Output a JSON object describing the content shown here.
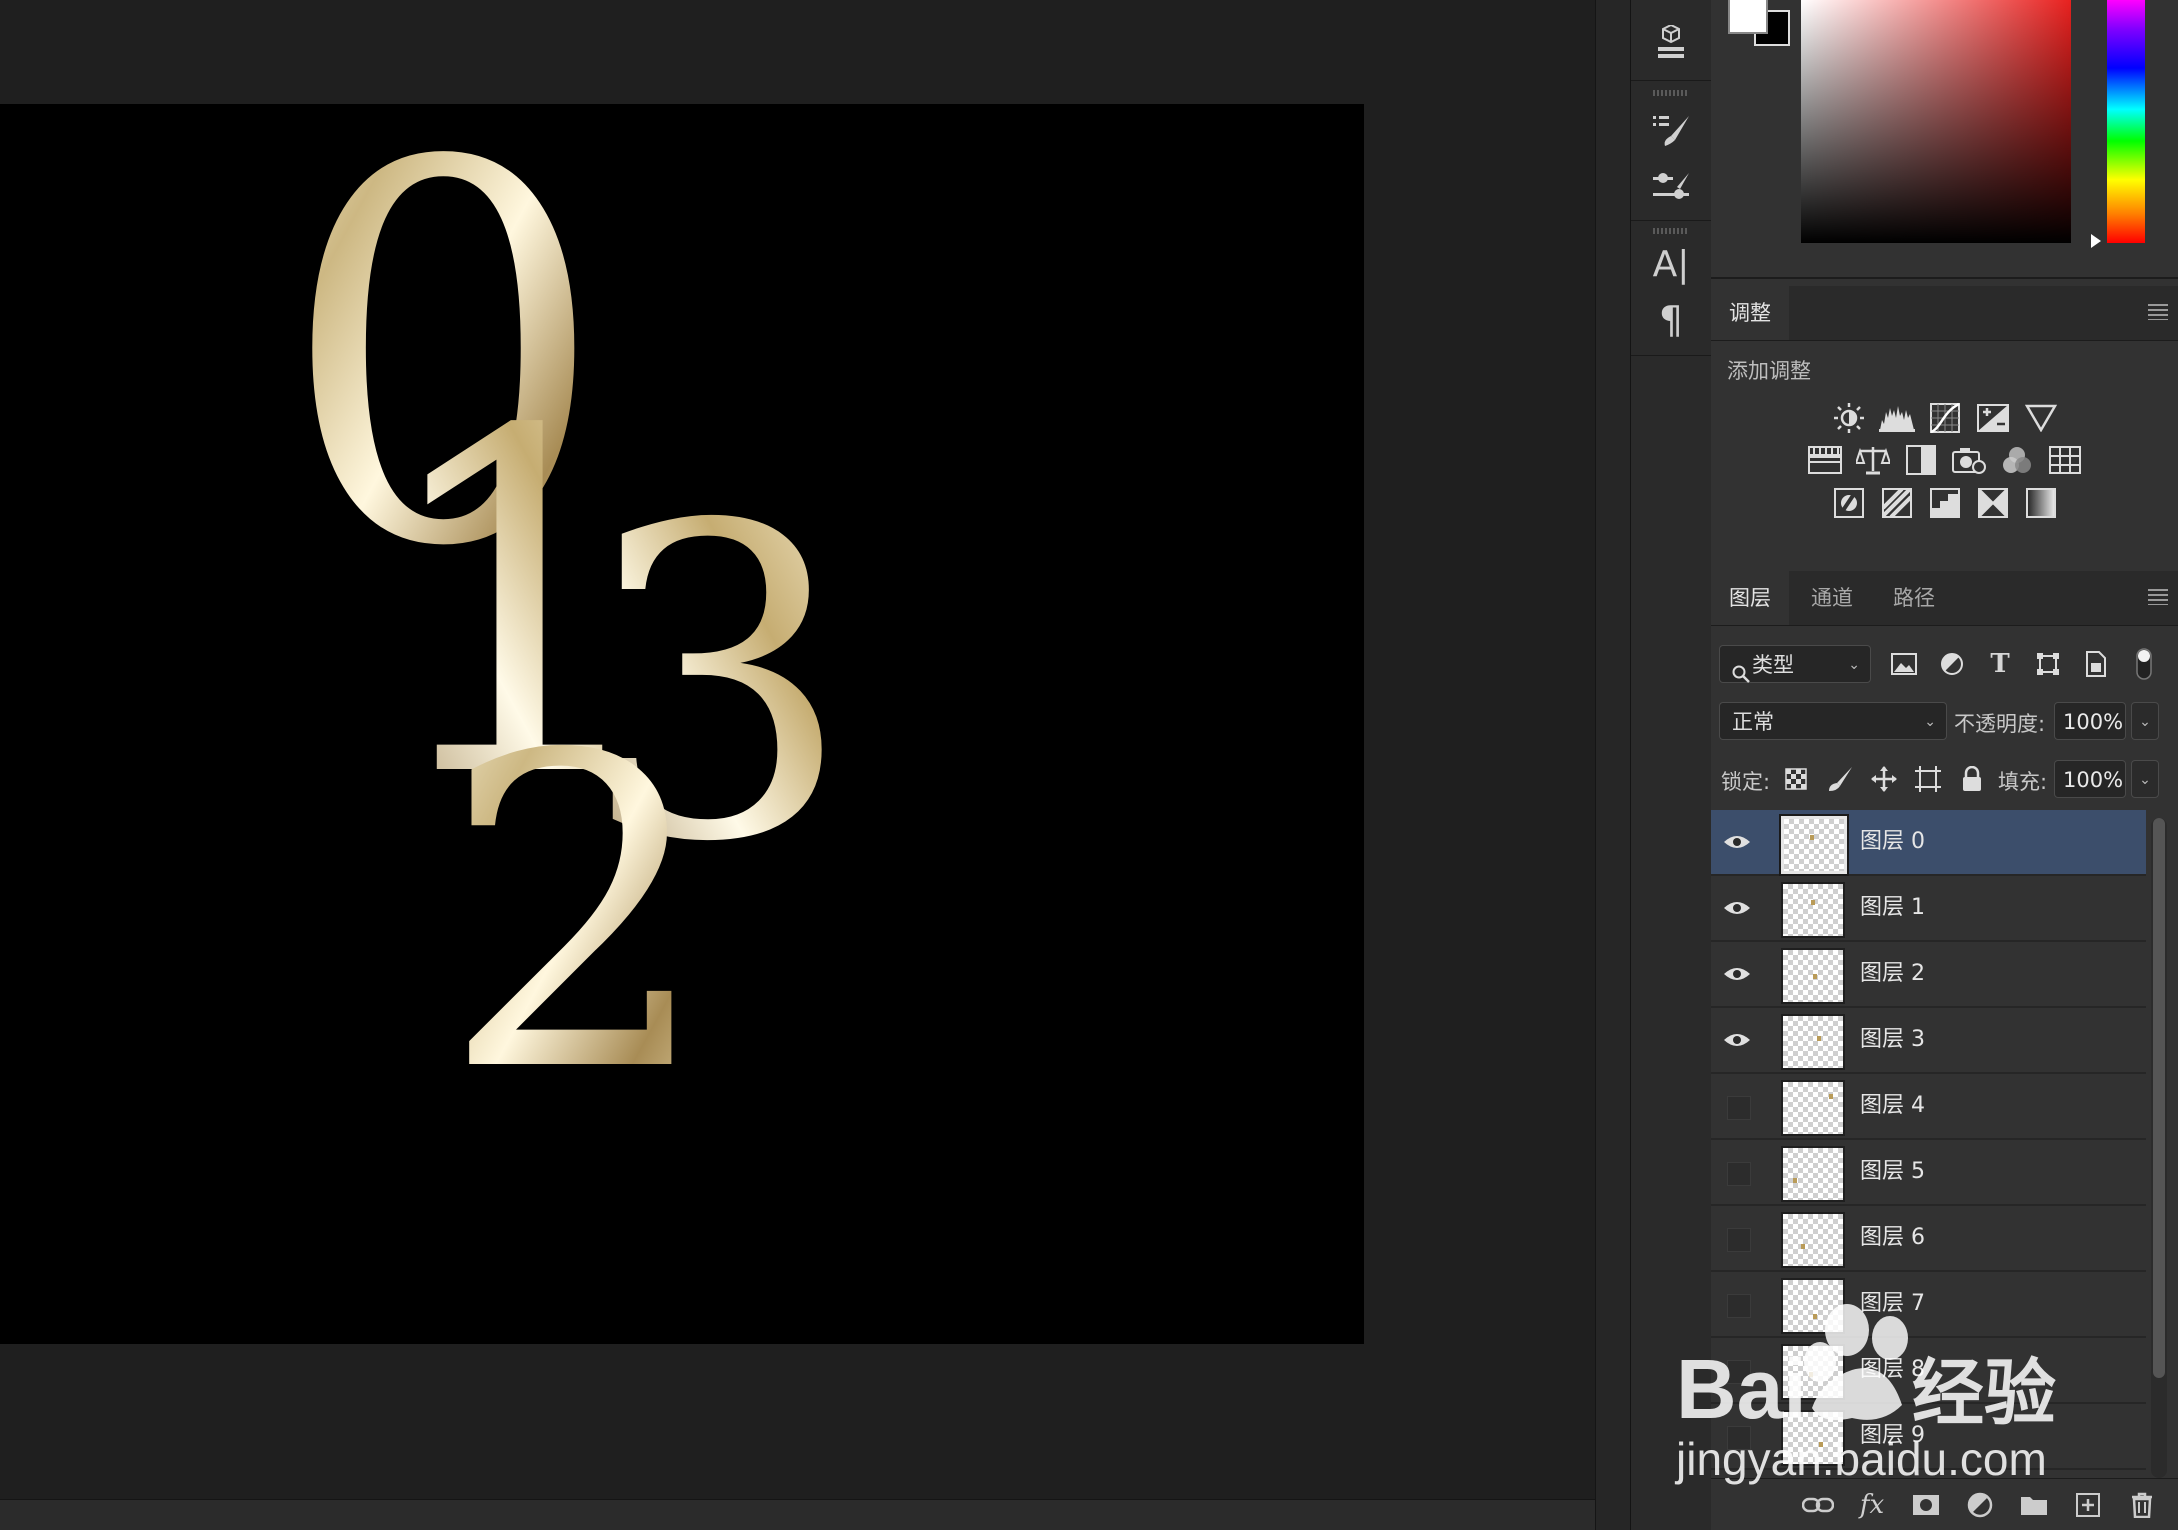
{
  "color_panel": {
    "foreground": "#ffffff",
    "background": "#000000",
    "hue_top": "#ff00ff",
    "hue_bottom": "#ff0000"
  },
  "artwork": {
    "digits": [
      "0",
      "1",
      "2",
      "3"
    ],
    "fill": "gold-gradient"
  },
  "adjust_panel": {
    "tab": "调整",
    "title": "添加调整",
    "icons_row1": [
      "brightness-icon",
      "levels-icon",
      "curves-icon",
      "exposure-icon",
      "vibrance-icon"
    ],
    "icons_row2": [
      "hue-saturation-icon",
      "color-balance-icon",
      "black-white-icon",
      "photo-filter-icon",
      "channel-mixer-icon",
      "color-lookup-icon"
    ],
    "icons_row3": [
      "invert-icon",
      "posterize-icon",
      "threshold-icon",
      "selective-color-icon",
      "gradient-map-icon"
    ]
  },
  "layers_panel": {
    "tabs": [
      "图层",
      "通道",
      "路径"
    ],
    "active_tab": "图层",
    "filter_label": "类型",
    "blend_mode": "正常",
    "opacity_label": "不透明度:",
    "opacity_value": "100%",
    "lock_label": "锁定:",
    "fill_label": "填充:",
    "fill_value": "100%",
    "layers": [
      {
        "name": "图层 0",
        "visible": true,
        "selected": true
      },
      {
        "name": "图层 1",
        "visible": true,
        "selected": false
      },
      {
        "name": "图层 2",
        "visible": true,
        "selected": false
      },
      {
        "name": "图层 3",
        "visible": true,
        "selected": false
      },
      {
        "name": "图层 4",
        "visible": false,
        "selected": false
      },
      {
        "name": "图层 5",
        "visible": false,
        "selected": false
      },
      {
        "name": "图层 6",
        "visible": false,
        "selected": false
      },
      {
        "name": "图层 7",
        "visible": false,
        "selected": false
      },
      {
        "name": "图层 8",
        "visible": false,
        "selected": false
      },
      {
        "name": "图层 9",
        "visible": false,
        "selected": false
      }
    ],
    "footer_icons": [
      "link-icon",
      "fx-icon",
      "mask-icon",
      "adjustment-icon",
      "folder-icon",
      "new-layer-icon",
      "trash-icon"
    ]
  },
  "watermark": {
    "brand": "Bai",
    "brand2": "经验",
    "url": "jingyan.baidu.com"
  }
}
